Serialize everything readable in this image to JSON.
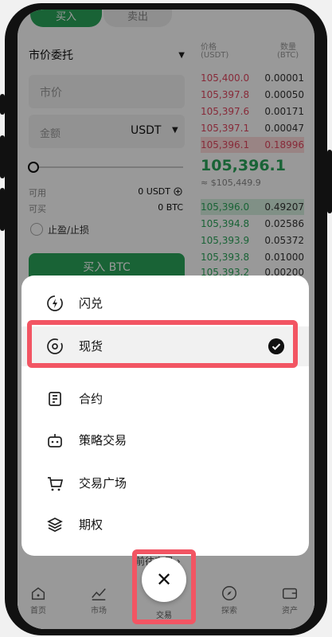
{
  "trade": {
    "tab_buy": "买入",
    "tab_sell": "卖出",
    "order_type": "市价委托",
    "price_placeholder": "市价",
    "amount_placeholder": "金额",
    "amount_unit": "USDT",
    "available_label": "可用",
    "available_value": "0 USDT",
    "sellable_label": "可买",
    "sellable_value": "0 BTC",
    "tp_sl_label": "止盈/止损",
    "buy_button": "买入 BTC"
  },
  "orderbook": {
    "col_price": "价格",
    "col_price_unit": "(USDT)",
    "col_qty": "数量",
    "col_qty_unit": "(BTC)",
    "asks": [
      {
        "price": "105,400.0",
        "qty": "0.00001"
      },
      {
        "price": "105,397.8",
        "qty": "0.00050"
      },
      {
        "price": "105,397.6",
        "qty": "0.00171"
      },
      {
        "price": "105,397.1",
        "qty": "0.00047"
      },
      {
        "price": "105,396.1",
        "qty": "0.18996"
      }
    ],
    "last_price": "105,396.1",
    "last_usd": "≈ $105,449.9",
    "bids": [
      {
        "price": "105,396.0",
        "qty": "0.49207"
      },
      {
        "price": "105,394.8",
        "qty": "0.02586"
      },
      {
        "price": "105,393.9",
        "qty": "0.05372"
      },
      {
        "price": "105,393.8",
        "qty": "0.01000"
      },
      {
        "price": "105,393.2",
        "qty": "0.00200"
      }
    ]
  },
  "menu": {
    "items": [
      {
        "label": "闪兑",
        "icon": "flash-convert-icon"
      },
      {
        "label": "现货",
        "icon": "spot-icon",
        "selected": true
      },
      {
        "label": "合约",
        "icon": "contract-icon"
      },
      {
        "label": "策略交易",
        "icon": "robot-icon"
      },
      {
        "label": "交易广场",
        "icon": "cart-icon"
      },
      {
        "label": "期权",
        "icon": "layers-icon"
      }
    ],
    "hint": "前往交易"
  },
  "nav": {
    "home": "首页",
    "markets": "市场",
    "trade": "交易",
    "discover": "探索",
    "assets": "资产"
  },
  "colors": {
    "accent_green": "#2aa55a",
    "ask_red": "#e2475f",
    "highlight": "#f25563"
  }
}
